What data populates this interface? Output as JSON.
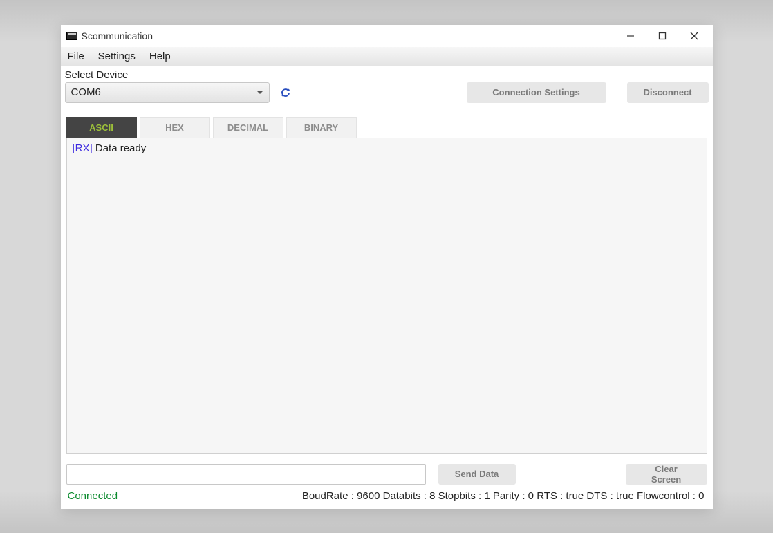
{
  "window": {
    "title": "Scommunication"
  },
  "menu": {
    "file": "File",
    "settings": "Settings",
    "help": "Help"
  },
  "device": {
    "label": "Select Device",
    "selected": "COM6",
    "connection_settings": "Connection Settings",
    "disconnect": "Disconnect"
  },
  "tabs": {
    "ascii": "ASCII",
    "hex": "HEX",
    "decimal": "DECIMAL",
    "binary": "BINARY"
  },
  "console": {
    "lines": [
      {
        "tag": "[RX]",
        "text": " Data ready"
      }
    ]
  },
  "input": {
    "value": "",
    "placeholder": ""
  },
  "buttons": {
    "send": "Send Data",
    "clear": "Clear Screen"
  },
  "status": {
    "connection": "Connected",
    "info": "BoudRate : 9600 Databits : 8 Stopbits : 1 Parity : 0 RTS : true DTS : true Flowcontrol : 0"
  }
}
